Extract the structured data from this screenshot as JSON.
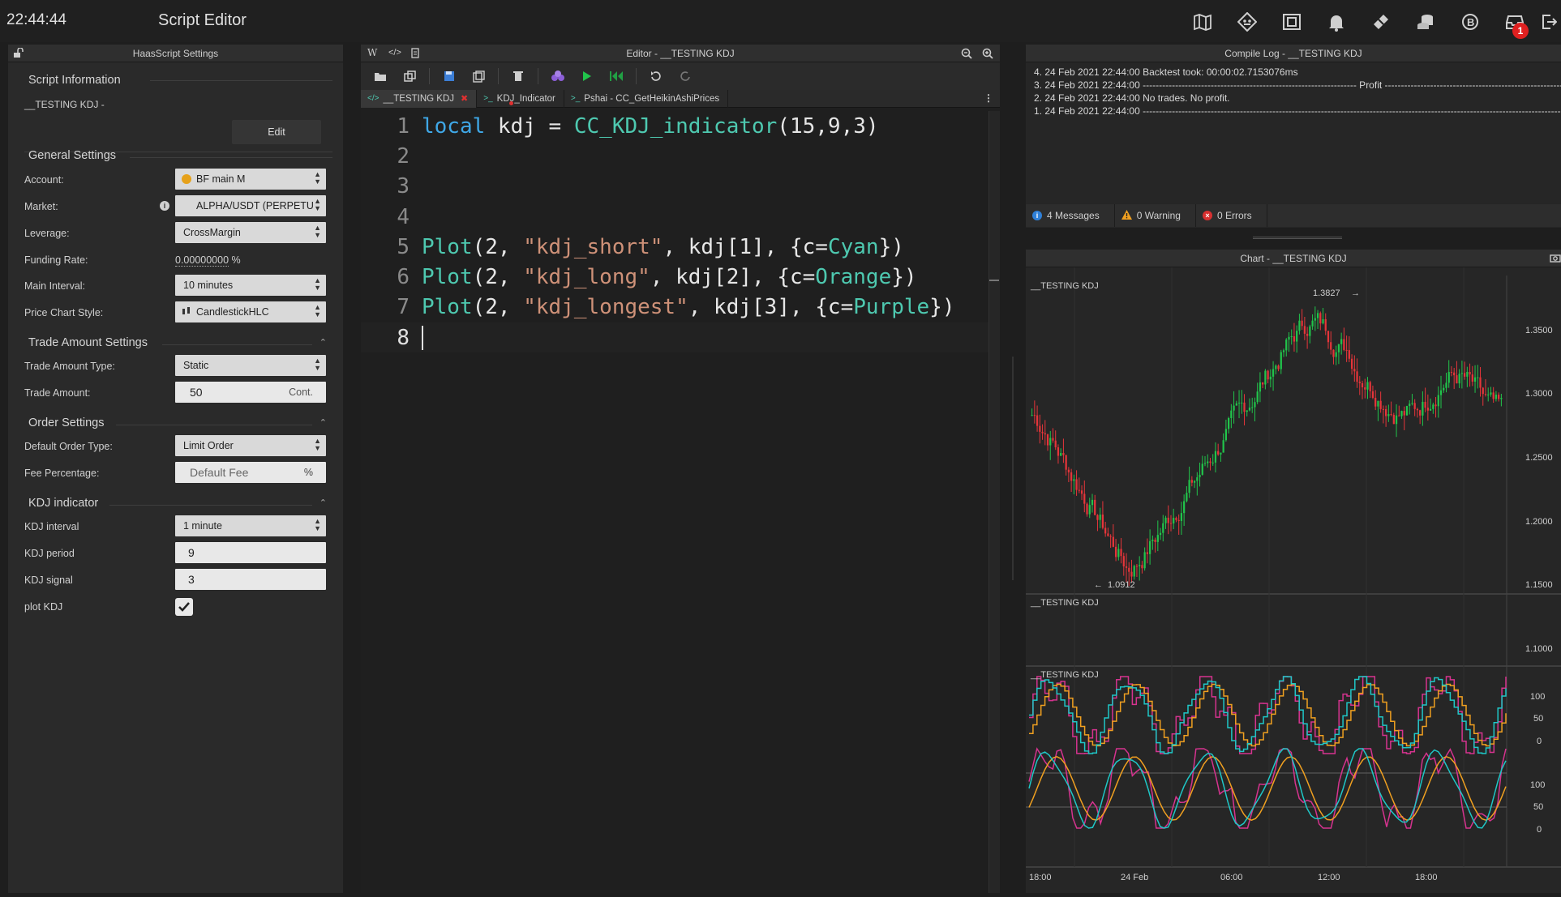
{
  "topbar": {
    "clock": "22:44:44",
    "title": "Script Editor",
    "icons": [
      "map-icon",
      "robot-icon",
      "frame-icon",
      "bell-icon",
      "ticket-icon",
      "coins-icon",
      "bitcoin-icon",
      "inbox-icon",
      "logout-icon"
    ],
    "inbox_badge": "1"
  },
  "settings": {
    "header": "HaasScript Settings",
    "script_info_title": "Script Information",
    "script_name": "__TESTING KDJ -",
    "edit_label": "Edit",
    "general_title": "General Settings",
    "account_label": "Account:",
    "account_value": "BF main M",
    "market_label": "Market:",
    "market_value": "ALPHA/USDT (PERPETU",
    "leverage_label": "Leverage:",
    "leverage_value": "CrossMargin",
    "funding_label": "Funding Rate:",
    "funding_value": "0.00000000",
    "funding_unit": "%",
    "interval_label": "Main Interval:",
    "interval_value": "10 minutes",
    "style_label": "Price Chart Style:",
    "style_value": "CandlestickHLC",
    "trade_title": "Trade Amount Settings",
    "trade_type_label": "Trade Amount Type:",
    "trade_type_value": "Static",
    "trade_amount_label": "Trade Amount:",
    "trade_amount_value": "50",
    "trade_amount_unit": "Cont.",
    "order_title": "Order Settings",
    "order_type_label": "Default Order Type:",
    "order_type_value": "Limit Order",
    "fee_label": "Fee Percentage:",
    "fee_placeholder": "Default Fee",
    "fee_unit": "%",
    "kdj_title": "KDJ indicator",
    "kdj_interval_label": "KDJ interval",
    "kdj_interval_value": "1 minute",
    "kdj_period_label": "KDJ period",
    "kdj_period_value": "9",
    "kdj_signal_label": "KDJ signal",
    "kdj_signal_value": "3",
    "plot_label": "plot KDJ",
    "plot_checked": true
  },
  "editor": {
    "header": "Editor - __TESTING KDJ",
    "tabs": [
      "__TESTING KDJ",
      "KDJ_Indicator",
      "Pshai - CC_GetHeikinAshiPrices"
    ],
    "line_numbers": [
      "1",
      "2",
      "3",
      "4",
      "5",
      "6",
      "7",
      "8"
    ],
    "code": {
      "l1": [
        "local",
        " kdj = ",
        "CC_KDJ_indicator",
        "(15,9,3)"
      ],
      "l5": [
        "Plot",
        "(2, ",
        "\"kdj_short\"",
        ", kdj[1], {c=",
        "Cyan",
        "})"
      ],
      "l6": [
        "Plot",
        "(2, ",
        "\"kdj_long\"",
        ", kdj[2], {c=",
        "Orange",
        "})"
      ],
      "l7": [
        "Plot",
        "(2, ",
        "\"kdj_longest\"",
        ", kdj[3], {c=",
        "Purple",
        "})"
      ]
    }
  },
  "compile_log": {
    "header": "Compile Log - __TESTING KDJ",
    "lines": [
      "4. 24 Feb 2021 22:44:00 Backtest took: 00:00:02.7153076ms",
      "3. 24 Feb 2021 22:44:00 ------------------------------------------------------------------ Profit -----------------------------------------------------------------",
      "2. 24 Feb 2021 22:44:00 No trades. No profit.",
      "1. 24 Feb 2021 22:44:00 -------------------------------------------------------------------------------------------------------------------------------------------"
    ],
    "messages": "4 Messages",
    "warnings": "0 Warning",
    "errors": "0 Errors"
  },
  "chart": {
    "header": "Chart - __TESTING KDJ",
    "pane_title": "__TESTING KDJ",
    "high_label": "1.3827",
    "low_label": "1.0912",
    "price_ticks": [
      "1.3500",
      "1.3000",
      "1.2500",
      "1.2000",
      "1.1500",
      "1.1000"
    ],
    "osc_ticks": [
      "100",
      "50",
      "0"
    ],
    "time_ticks": [
      "18:00",
      "24 Feb",
      "06:00",
      "12:00",
      "18:00"
    ],
    "colors": {
      "up": "#21c44b",
      "down": "#e5353a",
      "cyan": "#1fc7c7",
      "orange": "#f0a020",
      "purple": "#d6338f"
    }
  },
  "chart_data": {
    "type": "line",
    "title": "__TESTING KDJ",
    "ylim": [
      1.08,
      1.4
    ],
    "price_high": 1.3827,
    "price_low": 1.0912,
    "series": [
      {
        "name": "kdj_short",
        "color": "Cyan"
      },
      {
        "name": "kdj_long",
        "color": "Orange"
      },
      {
        "name": "kdj_longest",
        "color": "Purple"
      }
    ]
  }
}
